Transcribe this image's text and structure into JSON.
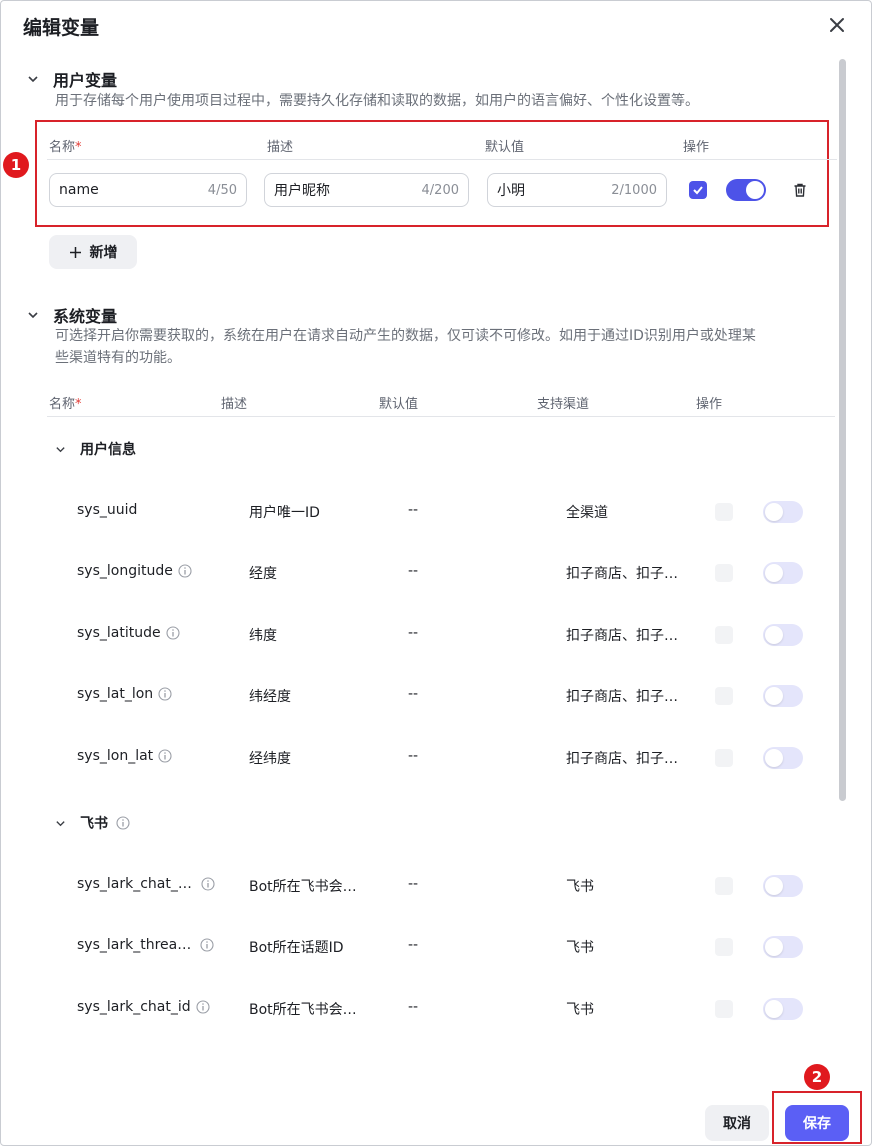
{
  "dialog": {
    "title": "编辑变量",
    "close_icon": "close-icon"
  },
  "markers": [
    "1",
    "2"
  ],
  "user_vars": {
    "title": "用户变量",
    "description": "用于存储每个用户使用项目过程中，需要持久化存储和读取的数据，如用户的语言偏好、个性化设置等。",
    "columns": {
      "name": "名称",
      "required_mark": "*",
      "desc": "描述",
      "default": "默认值",
      "action": "操作"
    },
    "row": {
      "name_value": "name",
      "name_count": "4/50",
      "desc_value": "用户昵称",
      "desc_count": "4/200",
      "default_value": "小明",
      "default_count": "2/1000",
      "checked": true,
      "enabled": true
    },
    "add_label": "新增"
  },
  "sys_vars": {
    "title": "系统变量",
    "description_line1": "可选择开启你需要获取的，系统在用户在请求自动产生的数据，仅可读不可修改。如用于通过ID识别用户或处理某",
    "description_line2": "些渠道特有的功能。",
    "columns": {
      "name": "名称",
      "required_mark": "*",
      "desc": "描述",
      "default": "默认值",
      "channel": "支持渠道",
      "action": "操作"
    },
    "groups": [
      {
        "title": "用户信息",
        "rows": [
          {
            "name": "sys_uuid",
            "desc": "用户唯一ID",
            "default": "--",
            "channel": "全渠道"
          },
          {
            "name": "sys_longitude",
            "desc": "经度",
            "default": "--",
            "channel": "扣子商店、扣子…"
          },
          {
            "name": "sys_latitude",
            "desc": "纬度",
            "default": "--",
            "channel": "扣子商店、扣子…"
          },
          {
            "name": "sys_lat_lon",
            "desc": "纬经度",
            "default": "--",
            "channel": "扣子商店、扣子…"
          },
          {
            "name": "sys_lon_lat",
            "desc": "经纬度",
            "default": "--",
            "channel": "扣子商店、扣子…"
          }
        ]
      },
      {
        "title": "飞书",
        "rows": [
          {
            "name": "sys_lark_chat_…",
            "desc": "Bot所在飞书会…",
            "default": "--",
            "channel": "飞书"
          },
          {
            "name": "sys_lark_threa…",
            "desc": "Bot所在话题ID",
            "default": "--",
            "channel": "飞书"
          },
          {
            "name": "sys_lark_chat_id",
            "desc": "Bot所在飞书会…",
            "default": "--",
            "channel": "飞书"
          }
        ]
      }
    ]
  },
  "footer": {
    "cancel_label": "取消",
    "save_label": "保存"
  },
  "colors": {
    "primary": "#4d53e8",
    "marker_red": "#e0191e",
    "highlight_border": "#d8232a"
  }
}
